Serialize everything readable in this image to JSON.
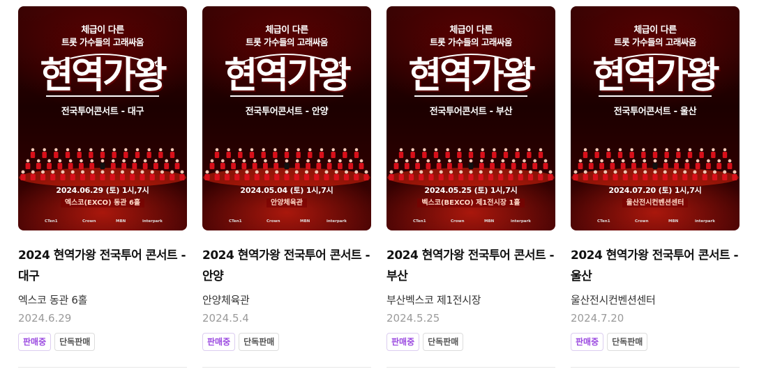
{
  "cards": [
    {
      "poster": {
        "subtitle_line1": "체급이 다른",
        "subtitle_line2": "트롯 가수들의 고래싸움",
        "title": "현역가왕",
        "tour": "전국투어콘서트 - 대구",
        "date_line": "2024.06.29 (토) 1시,7시",
        "venue_line": "엑스코(EXCO) 동관 6홀"
      },
      "title": "2024 현역가왕 전국투어 콘서트 - 대구",
      "venue": "엑스코 동관 6홀",
      "date": "2024.6.29",
      "badges": [
        "판매중",
        "단독판매"
      ]
    },
    {
      "poster": {
        "subtitle_line1": "체급이 다른",
        "subtitle_line2": "트롯 가수들의 고래싸움",
        "title": "현역가왕",
        "tour": "전국투어콘서트 - 안양",
        "date_line": "2024.05.04 (토) 1시,7시",
        "venue_line": "안양체육관"
      },
      "title": "2024 현역가왕 전국투어 콘서트 - 안양",
      "venue": "안양체육관",
      "date": "2024.5.4",
      "badges": [
        "판매중",
        "단독판매"
      ]
    },
    {
      "poster": {
        "subtitle_line1": "체급이 다른",
        "subtitle_line2": "트롯 가수들의 고래싸움",
        "title": "현역가왕",
        "tour": "전국투어콘서트 - 부산",
        "date_line": "2024.05.25 (토) 1시,7시",
        "venue_line": "벡스코(BEXCO) 제1전시장 1홀"
      },
      "title": "2024 현역가왕 전국투어 콘서트 - 부산",
      "venue": "부산벡스코 제1전시장",
      "date": "2024.5.25",
      "badges": [
        "판매중",
        "단독판매"
      ]
    },
    {
      "poster": {
        "subtitle_line1": "체급이 다른",
        "subtitle_line2": "트롯 가수들의 고래싸움",
        "title": "현역가왕",
        "tour": "전국투어콘서트 - 울산",
        "date_line": "2024.07.20 (토) 1시,7시",
        "venue_line": "울산전시컨벤션센터"
      },
      "title": "2024 현역가왕 전국투어 콘서트 - 울산",
      "venue": "울산전시컨벤션센터",
      "date": "2024.7.20",
      "badges": [
        "판매중",
        "단독판매"
      ]
    }
  ],
  "sponsors": [
    "CTen1",
    "Crown",
    "MBN",
    "interpark"
  ],
  "colors": {
    "on_sale_badge": "#9b4ae0",
    "poster_red": "#b00000"
  }
}
